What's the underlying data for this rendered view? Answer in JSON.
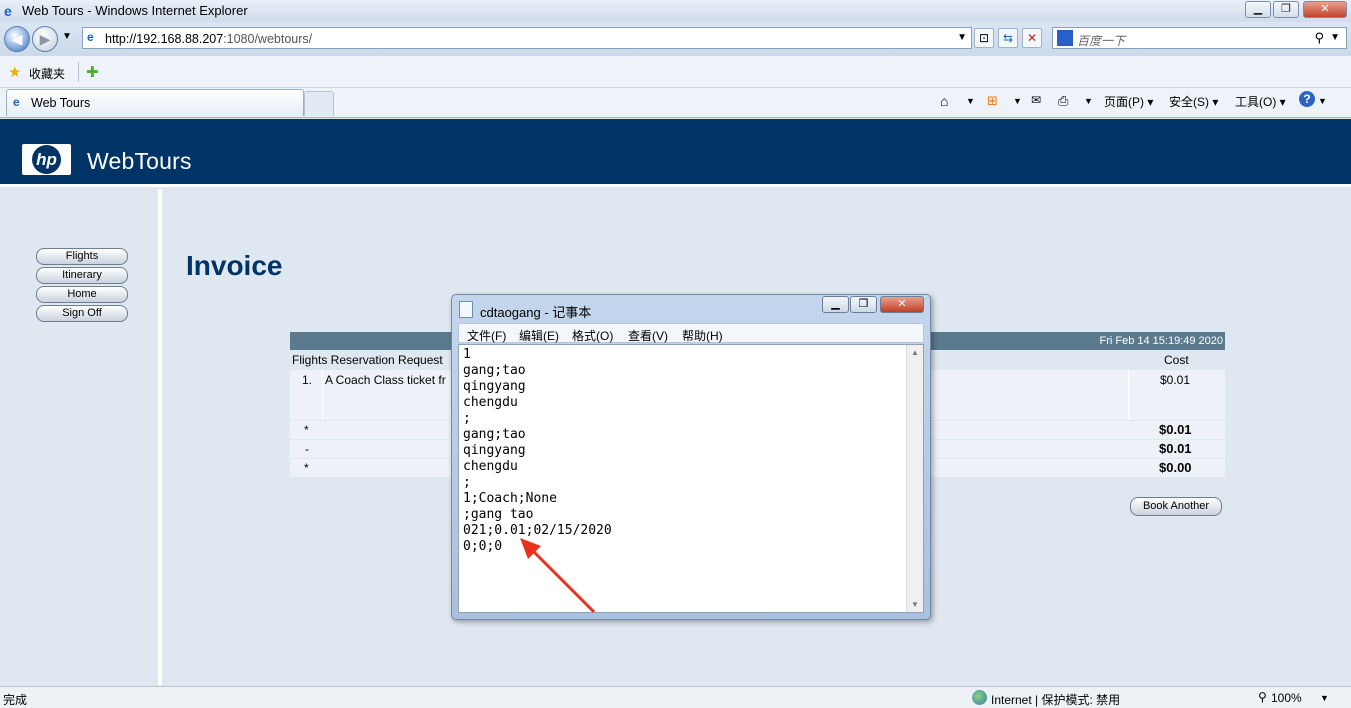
{
  "window": {
    "title": "Web Tours - Windows Internet Explorer"
  },
  "address": {
    "url_prefix": "http://",
    "host": "192.168.88.207",
    "url_suffix": ":1080/webtours/"
  },
  "search": {
    "placeholder": "百度一下"
  },
  "favorites": {
    "label": "收藏夹"
  },
  "tab": {
    "label": "Web Tours"
  },
  "commands": {
    "page": "页面(P)",
    "safety": "安全(S)",
    "tools": "工具(O)"
  },
  "site": {
    "brand": "WebTours",
    "logo": "hp",
    "nav": [
      "Flights",
      "Itinerary",
      "Home",
      "Sign Off"
    ],
    "heading": "Invoice",
    "invoice": {
      "date": "Fri Feb 14 15:19:49 2020",
      "col_item": "Flights Reservation Request",
      "col_cost": "Cost",
      "line_no": "1.",
      "line_desc": "A Coach Class ticket fr",
      "line_cost": "$0.01",
      "totals": [
        {
          "mark": "*",
          "value": "$0.01"
        },
        {
          "mark": "-",
          "value": "$0.01"
        },
        {
          "mark": "*",
          "value": "$0.00"
        }
      ],
      "book_another": "Book Another"
    }
  },
  "notepad": {
    "title": "cdtaogang - 记事本",
    "menu": [
      "文件(F)",
      "编辑(E)",
      "格式(O)",
      "查看(V)",
      "帮助(H)"
    ],
    "content": "1\ngang;tao\nqingyang\nchengdu\n;\ngang;tao\nqingyang\nchengdu\n;\n1;Coach;None\n;gang tao\n021;0.01;02/15/2020\n0;0;0"
  },
  "statusbar": {
    "left": "完成",
    "zone": "Internet | 保护模式: 禁用",
    "zoom": "100%"
  },
  "colors": {
    "hp_blue": "#003466",
    "page_bg": "#dfe8f1",
    "arrow": "#e8321e",
    "invoice_header": "#5c7a8d"
  }
}
